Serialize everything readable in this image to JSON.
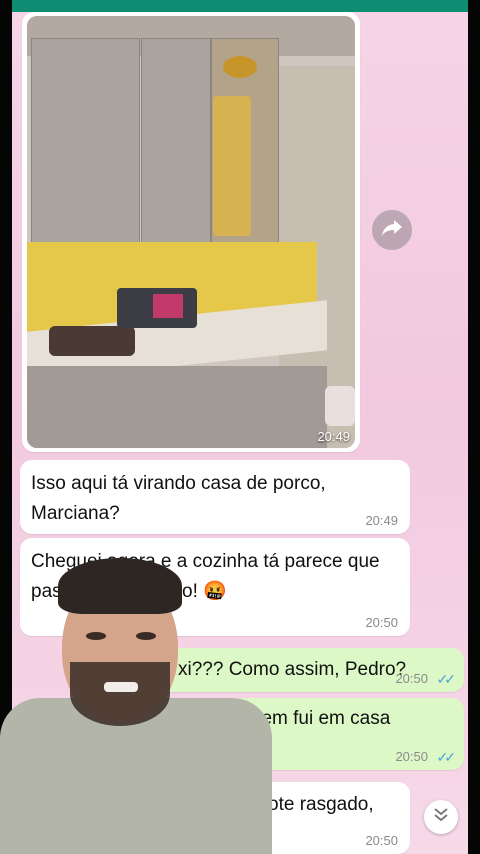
{
  "photo_message": {
    "time": "20:49"
  },
  "messages": [
    {
      "id": "m1",
      "text": "Isso aqui tá virando casa de porco, Marciana?",
      "time": "20:49",
      "direction": "in"
    },
    {
      "id": "m2",
      "text": "Cheguei agora e a cozinha tá parece que passou um furacão! 🤬",
      "time": "20:50",
      "direction": "in"
    },
    {
      "id": "m3",
      "text": "xi??? Como assim, Pedro?",
      "time": "20:50",
      "direction": "out"
    },
    {
      "id": "m4",
      "text": "o ainda, nem fui em casa",
      "time": "20:50",
      "direction": "out"
    },
    {
      "id": "m5",
      "text": "ote rasgado,",
      "time": "20:50",
      "direction": "in"
    }
  ],
  "read_ticks": "✓✓",
  "icons": {
    "forward": "forward-icon",
    "scroll_down": "chevron-double-down-icon"
  },
  "colors": {
    "header": "#0e8d72",
    "incoming": "#ffffff",
    "outgoing": "#dcf8c6",
    "read_tick": "#4aa3df"
  }
}
